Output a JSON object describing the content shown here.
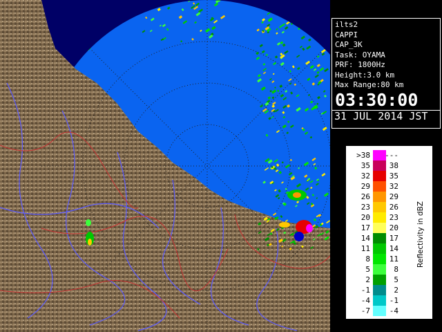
{
  "info": {
    "product_id": "ilts2",
    "product": "CAPPI",
    "product_name": "CAP_3K",
    "task": "Task: OYAMA",
    "prf": "PRF: 1800Hz",
    "height": "Height:3.0 km",
    "max_range": "Max Range:80 km",
    "time": "03:30:00",
    "date": "31 JUL 2014 JST"
  },
  "legend": {
    "unit_label": "Reflectivity in dBZ",
    "rows": [
      {
        "low": ">38",
        "high": "---",
        "color": "#ff00ff"
      },
      {
        "low": "35",
        "high": "38",
        "color": "#c8005a"
      },
      {
        "low": "32",
        "high": "35",
        "color": "#e60000"
      },
      {
        "low": "29",
        "high": "32",
        "color": "#ff5000"
      },
      {
        "low": "26",
        "high": "29",
        "color": "#ff9600"
      },
      {
        "low": "23",
        "high": "26",
        "color": "#ffc800"
      },
      {
        "low": "20",
        "high": "23",
        "color": "#ffeb00"
      },
      {
        "low": "17",
        "high": "20",
        "color": "#ffff5a"
      },
      {
        "low": "14",
        "high": "17",
        "color": "#008c00"
      },
      {
        "low": "11",
        "high": "14",
        "color": "#00c800"
      },
      {
        "low": "8",
        "high": "11",
        "color": "#00e600"
      },
      {
        "low": "5",
        "high": "8",
        "color": "#3cff3c"
      },
      {
        "low": "2",
        "high": "5",
        "color": "#00a000"
      },
      {
        "low": "-1",
        "high": "2",
        "color": "#008c8c"
      },
      {
        "low": "-4",
        "high": "-1",
        "color": "#00c8c8"
      },
      {
        "low": "-7",
        "high": "-4",
        "color": "#64ffff"
      }
    ]
  },
  "colors": {
    "sea": "#0a64f0",
    "outside": "#000066",
    "land": "#8b7355",
    "rivers": "#5a5aff",
    "borders": "#c83232"
  }
}
